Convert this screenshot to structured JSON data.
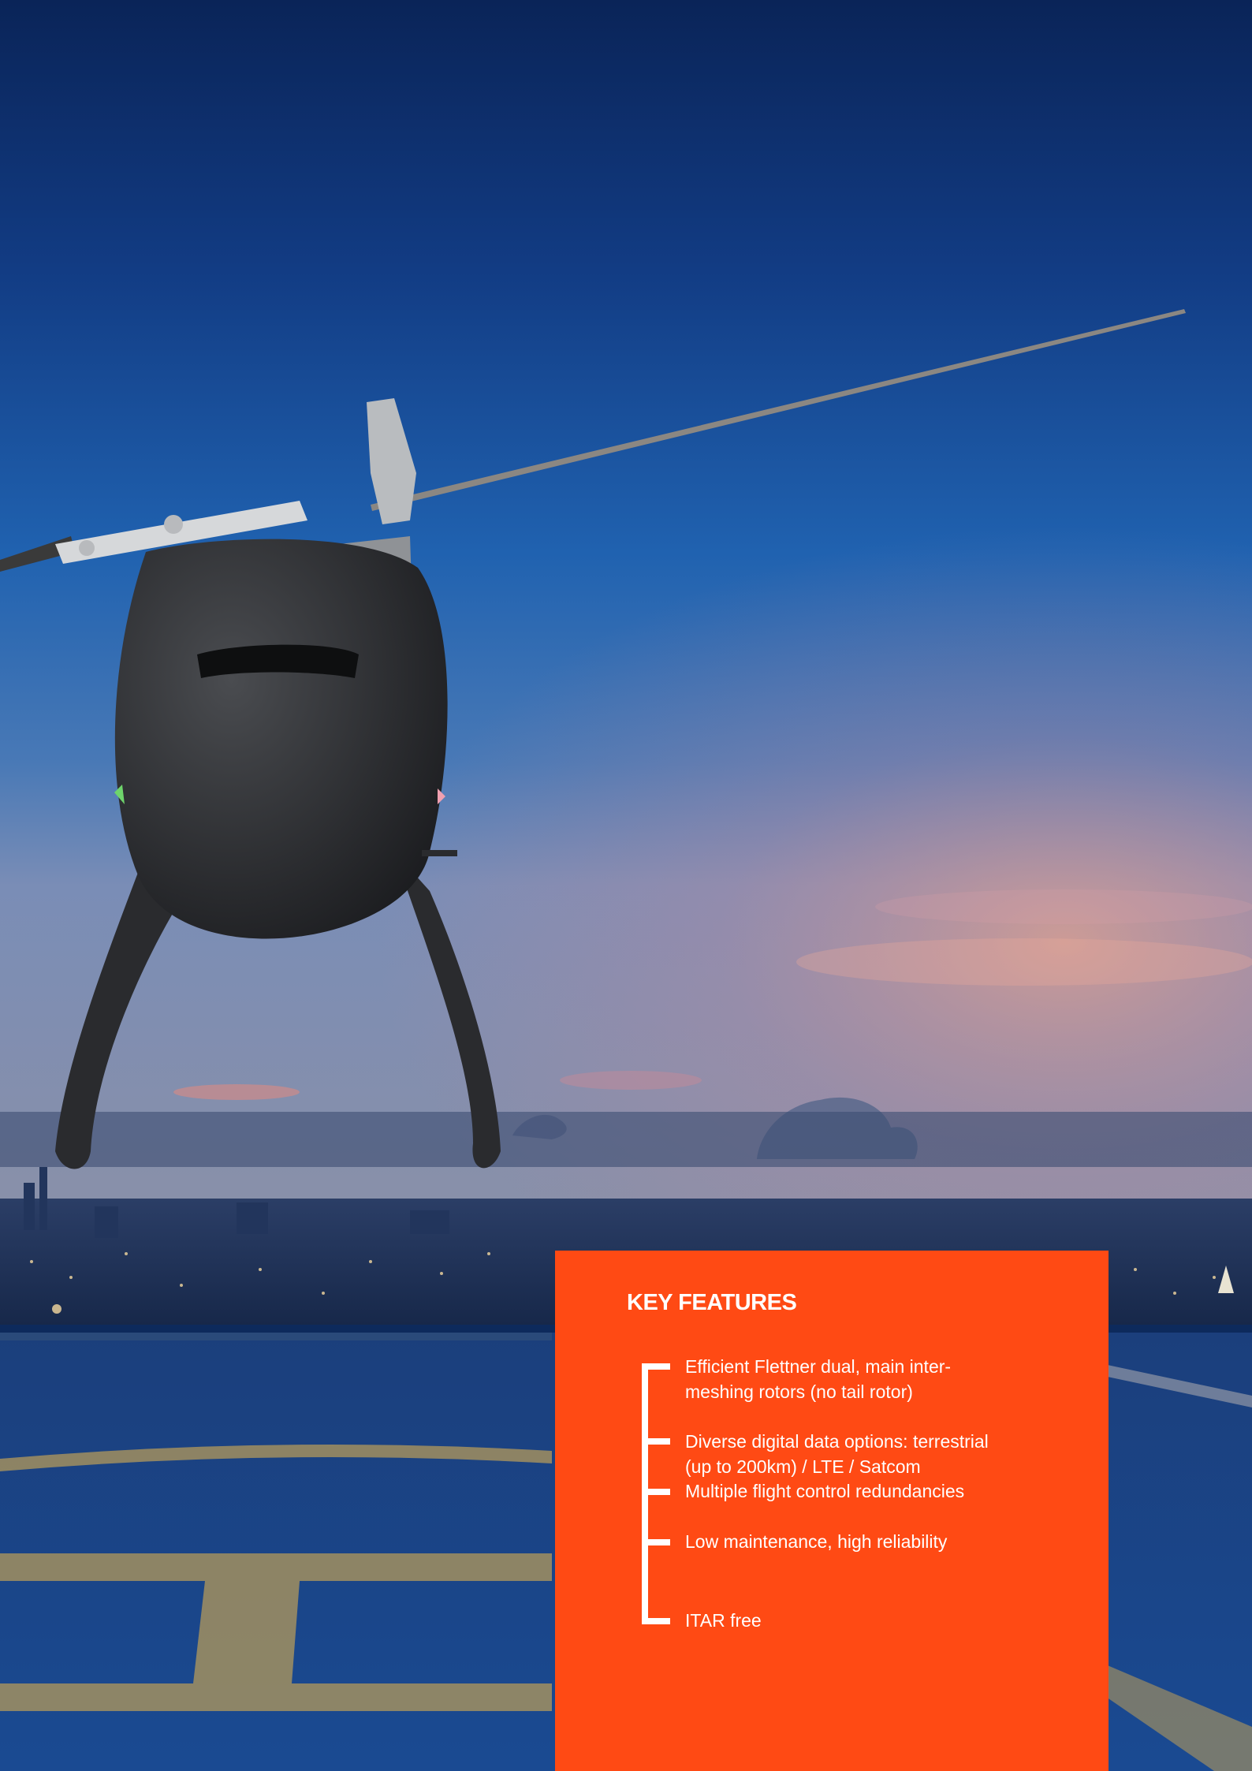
{
  "colors": {
    "card_background": "#ff4a14",
    "text": "#ffffff",
    "sky_top": "#0a2a63",
    "sky_mid": "#1f5fae",
    "horizon_glow": "#e59a8a"
  },
  "key_features": {
    "title": "KEY FEATURES",
    "items": [
      {
        "label": "Efficient Flettner dual, main inter-\nmeshing rotors (no tail rotor)"
      },
      {
        "label": "Diverse digital data options: terrestrial\n(up to 200km) / LTE / Satcom"
      },
      {
        "label": "Multiple flight control redundancies"
      },
      {
        "label": "Low maintenance, high reliability"
      },
      {
        "label": "ITAR free"
      }
    ]
  }
}
